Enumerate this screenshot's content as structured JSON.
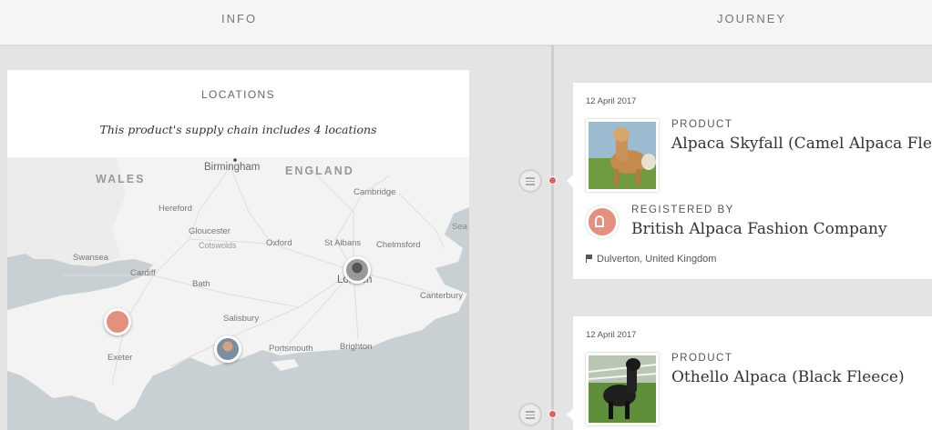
{
  "tabs": {
    "info": "INFO",
    "journey": "JOURNEY"
  },
  "locations": {
    "title": "LOCATIONS",
    "subtitle": "This product's supply chain includes 4 locations",
    "map_labels": {
      "wales": "WALES",
      "england": "ENGLAND",
      "birmingham": "Birmingham",
      "cambridge": "Cambridge",
      "hereford": "Hereford",
      "gloucester": "Gloucester",
      "cotswolds": "Cotswolds",
      "oxford": "Oxford",
      "st_albans": "St Albans",
      "chelmsford": "Chelmsford",
      "swansea": "Swansea",
      "cardiff": "Cardiff",
      "bath": "Bath",
      "london": "London",
      "canterbury": "Canterbury",
      "salisbury": "Salisbury",
      "exeter": "Exeter",
      "portsmouth": "Portsmouth",
      "brighton": "Brighton",
      "sea": "Sea"
    }
  },
  "journey": [
    {
      "date": "12 April 2017",
      "product_label": "PRODUCT",
      "product_name": "Alpaca Skyfall (Camel Alpaca Fleece)",
      "registered_label": "REGISTERED BY",
      "registered_by": "British Alpaca Fashion Company",
      "location": "Dulverton, United Kingdom"
    },
    {
      "date": "12 April 2017",
      "product_label": "PRODUCT",
      "product_name": "Othello Alpaca (Black Fleece)"
    }
  ],
  "colors": {
    "accent": "#de6060",
    "brand": "#e4907f"
  }
}
